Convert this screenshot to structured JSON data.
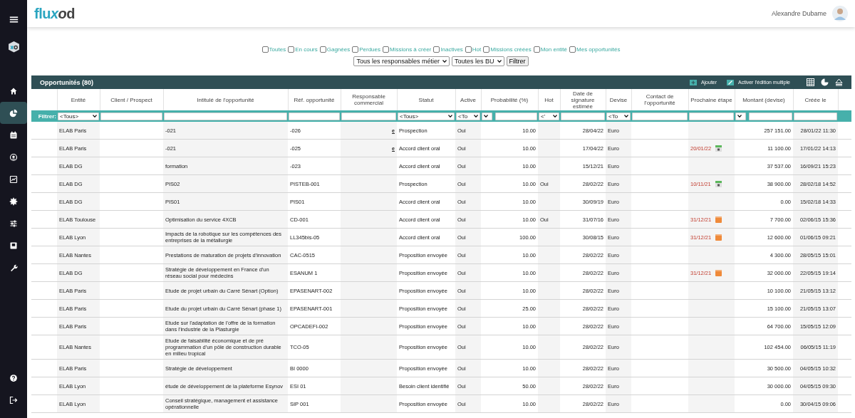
{
  "sidebar": {
    "items": [
      {
        "selected": false
      },
      {
        "selected": true
      },
      {
        "selected": false
      },
      {
        "selected": false
      },
      {
        "selected": false
      },
      {
        "selected": false
      },
      {
        "selected": false
      },
      {
        "selected": false
      },
      {
        "selected": false
      }
    ],
    "bottom_items": [
      {
        "selected": false
      },
      {
        "selected": false
      }
    ]
  },
  "header": {
    "logo": "fluxod",
    "user_name": "Alexandre Dubame"
  },
  "filters": {
    "checkboxes": [
      {
        "label": "Toutes",
        "checked": false
      },
      {
        "label": "En cours",
        "checked": false
      },
      {
        "label": "Gagnées",
        "checked": false
      },
      {
        "label": "Perdues",
        "checked": false
      },
      {
        "label": "Missions à créer",
        "checked": false
      },
      {
        "label": "Inactives",
        "checked": false
      },
      {
        "label": "Hot",
        "checked": false
      },
      {
        "label": "Missions créées",
        "checked": false
      },
      {
        "label": "Mon entité",
        "checked": false
      },
      {
        "label": "Mes opportunités",
        "checked": false
      }
    ],
    "selects": [
      "Tous les responsables métier",
      "Toutes les BU"
    ],
    "button": "Filtrer"
  },
  "table": {
    "title": "Opportunités (80)",
    "actions": [
      {
        "kind": "add",
        "label": "Ajouter"
      },
      {
        "kind": "edit",
        "label": "Activer l'édition multiple"
      }
    ],
    "filter_label": "Filtrer:",
    "columns": [
      {
        "label": "Entité",
        "filter": {
          "kind": "select",
          "value": "<Tous>"
        }
      },
      {
        "label": "Client / Prospect",
        "filter": {
          "kind": "input"
        }
      },
      {
        "label": "Intitulé de l'opportunité",
        "filter": {
          "kind": "input"
        }
      },
      {
        "label": "Réf. opportunité",
        "filter": {
          "kind": "input"
        }
      },
      {
        "label": "Responsable commercial",
        "filter": {
          "kind": "input"
        }
      },
      {
        "label": "Statut",
        "filter": {
          "kind": "select",
          "value": "<Tous>"
        }
      },
      {
        "label": "Active",
        "filter": {
          "kind": "select",
          "value": "<To"
        }
      },
      {
        "label": "Probabilité (%)",
        "filter": {
          "kind": "combo"
        }
      },
      {
        "label": "Hot",
        "filter": {
          "kind": "select",
          "value": "<'"
        }
      },
      {
        "label": "Date de signature estimée",
        "filter": {
          "kind": "input"
        }
      },
      {
        "label": "Devise",
        "filter": {
          "kind": "select",
          "value": "<To"
        }
      },
      {
        "label": "Contact de l'opportunité",
        "filter": {
          "kind": "input"
        }
      },
      {
        "label": "Prochaine étape",
        "filter": {
          "kind": "input"
        }
      },
      {
        "label": "Montant (devise)",
        "filter": {
          "kind": "combo"
        }
      },
      {
        "label": "Créée le",
        "filter": {
          "kind": "input"
        }
      }
    ],
    "rows": [
      {
        "entity": "ELAB Paris",
        "title": "-021",
        "ref": "-026",
        "owner": "e",
        "status": "Prospection",
        "active": "Oui",
        "probability": "10.00",
        "date": "28/04/22",
        "currency": "Euro",
        "amount": "257 151.00",
        "created": "28/01/22 11:30"
      },
      {
        "entity": "ELAB Paris",
        "title": "-021",
        "ref": "-025",
        "owner": "e",
        "status": "Accord client oral",
        "active": "Oui",
        "probability": "10.00",
        "date": "17/04/22",
        "currency": "Euro",
        "next_step": {
          "date": "20/01/22",
          "kind": "calendar"
        },
        "amount": "11 100.00",
        "created": "17/01/22 14:13"
      },
      {
        "entity": "ELAB DG",
        "title": "formation",
        "ref": "-023",
        "status": "Accord client oral",
        "active": "Oui",
        "probability": "10.00",
        "date": "15/12/21",
        "currency": "Euro",
        "amount": "37 537.00",
        "created": "16/09/21 15:23"
      },
      {
        "entity": "ELAB DG",
        "title": "PIS02",
        "ref": "PISTEB-001",
        "status": "Prospection",
        "active": "Oui",
        "probability": "10.00",
        "hot": "Oui",
        "date": "28/02/22",
        "currency": "Euro",
        "next_step": {
          "date": "10/11/21",
          "kind": "calendar"
        },
        "amount": "38 900.00",
        "created": "28/02/18 14:52"
      },
      {
        "entity": "ELAB DG",
        "title": "PIS01",
        "ref": "PIS01",
        "status": "Accord client oral",
        "active": "Oui",
        "probability": "10.00",
        "date": "30/09/19",
        "currency": "Euro",
        "amount": "0.00",
        "created": "15/02/18 14:33"
      },
      {
        "entity": "ELAB Toulouse",
        "title": "Optimisation du service 4XCB",
        "ref": "CD-001",
        "status": "Accord client oral",
        "active": "Oui",
        "probability": "10.00",
        "hot": "Oui",
        "date": "31/07/16",
        "currency": "Euro",
        "next_step": {
          "date": "31/12/21",
          "kind": "note"
        },
        "amount": "7 700.00",
        "created": "02/06/15 15:36"
      },
      {
        "entity": "ELAB Lyon",
        "title": "Impacts de la robotique sur les compétences des entreprises de la métallurgie",
        "ref": "LL345bis-05",
        "status": "Accord client oral",
        "active": "Oui",
        "probability": "100.00",
        "date": "30/08/15",
        "currency": "Euro",
        "next_step": {
          "date": "31/12/21",
          "kind": "note"
        },
        "amount": "12 600.00",
        "created": "01/06/15 09:21"
      },
      {
        "entity": "ELAB Nantes",
        "title": "Prestations de maturation de projets d'innovation",
        "ref": "CAC-0515",
        "status": "Proposition envoyée",
        "active": "Oui",
        "probability": "10.00",
        "date": "28/02/22",
        "currency": "Euro",
        "amount": "4 300.00",
        "created": "28/05/15 15:01"
      },
      {
        "entity": "ELAB DG",
        "title": "Stratégie de développement en France d'un réseau social pour médecins",
        "ref": "ESANUM 1",
        "status": "Proposition envoyée",
        "active": "Oui",
        "probability": "10.00",
        "date": "28/02/22",
        "currency": "Euro",
        "next_step": {
          "date": "31/12/21",
          "kind": "note"
        },
        "amount": "32 000.00",
        "created": "22/05/15 19:14"
      },
      {
        "entity": "ELAB Paris",
        "title": "Etude de projet urbain du Carré Sénart (Option)",
        "ref": "EPASENART-002",
        "status": "Proposition envoyée",
        "active": "Oui",
        "probability": "10.00",
        "date": "28/02/22",
        "currency": "Euro",
        "amount": "10 100.00",
        "created": "21/05/15 13:12"
      },
      {
        "entity": "ELAB Paris",
        "title": "Etude du projet urbain du Carré Sénart (phase 1)",
        "ref": "EPASENART-001",
        "status": "Proposition envoyée",
        "active": "Oui",
        "probability": "25.00",
        "date": "28/02/22",
        "currency": "Euro",
        "amount": "15 100.00",
        "created": "21/05/15 13:07"
      },
      {
        "entity": "ELAB Paris",
        "title": "Etude sur l'adaptation de l'offre de la formation dans l'industrie de la Plasturgie",
        "ref": "OPCADEFI-002",
        "status": "Proposition envoyée",
        "active": "Oui",
        "probability": "10.00",
        "date": "28/02/22",
        "currency": "Euro",
        "amount": "64 700.00",
        "created": "15/05/15 12:09"
      },
      {
        "entity": "ELAB Nantes",
        "title": "Etude de faisabilité économique et de pré programmation d'un pôle de construction durable en milieu tropical",
        "ref": "TCO-05",
        "status": "Proposition envoyée",
        "active": "Oui",
        "probability": "10.00",
        "date": "28/02/22",
        "currency": "Euro",
        "amount": "102 454.00",
        "created": "06/05/15 11:19"
      },
      {
        "entity": "ELAB Paris",
        "title": "Stratégie de développement",
        "ref": "BI 0000",
        "status": "Proposition envoyée",
        "active": "Oui",
        "probability": "10.00",
        "date": "28/02/22",
        "currency": "Euro",
        "amount": "30 500.00",
        "created": "04/05/15 10:32"
      },
      {
        "entity": "ELAB Lyon",
        "title": "étude de développement de la plateforme Esynov",
        "ref": "ESI 01",
        "status": "Besoin client identifié",
        "active": "Oui",
        "probability": "50.00",
        "date": "28/02/22",
        "currency": "Euro",
        "amount": "30 000.00",
        "created": "04/05/15 09:30"
      },
      {
        "entity": "ELAB Lyon",
        "title": "Conseil stratégique, management et assistance opérationnelle",
        "ref": "SIP 001",
        "status": "Proposition envoyée",
        "active": "Oui",
        "probability": "10.00",
        "date": "28/02/22",
        "currency": "Euro",
        "amount": "0.00",
        "created": "30/04/15 09:06"
      }
    ]
  }
}
